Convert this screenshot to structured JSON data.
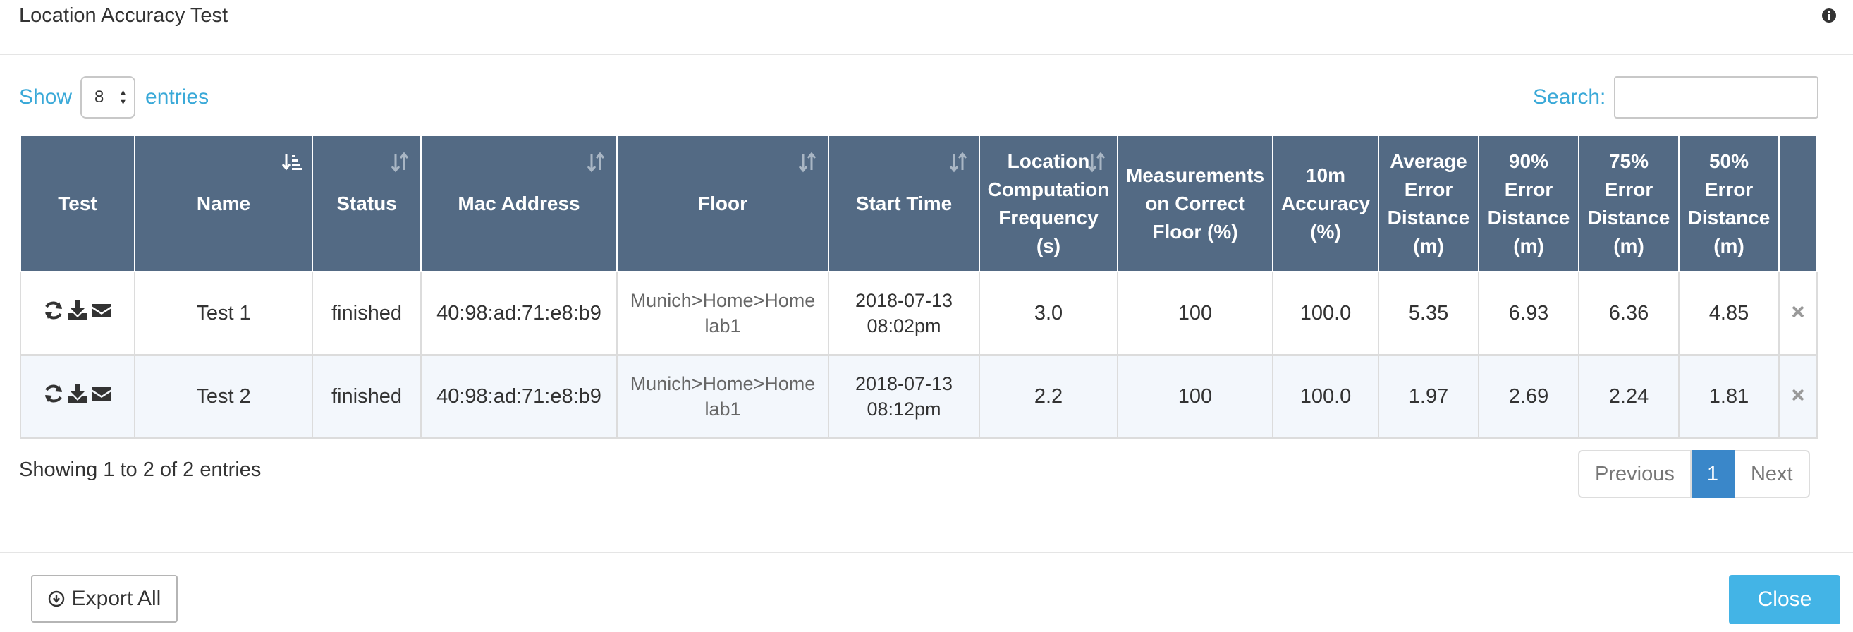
{
  "dialog": {
    "title": "Location Accuracy Test"
  },
  "toolbar": {
    "show_label": "Show",
    "page_length": "8",
    "entries_label": "entries",
    "search_label": "Search:",
    "search_value": ""
  },
  "table": {
    "columns": [
      "Test",
      "Name",
      "Status",
      "Mac Address",
      "Floor",
      "Start Time",
      "Location Computation Frequency (s)",
      "Measurements on Correct Floor (%)",
      "10m Accuracy (%)",
      "Average Error Distance (m)",
      "90% Error Distance (m)",
      "75% Error Distance (m)",
      "50% Error Distance (m)",
      ""
    ],
    "rows": [
      {
        "name": "Test 1",
        "status": "finished",
        "mac": "40:98:ad:71:e8:b9",
        "floor": "Munich>Home>Home lab1",
        "start_date": "2018-07-13",
        "start_clock": "08:02pm",
        "frequency": "3.0",
        "correct_floor": "100",
        "accuracy_10m": "100.0",
        "avg_error": "5.35",
        "err_90": "6.93",
        "err_75": "6.36",
        "err_50": "4.85"
      },
      {
        "name": "Test 2",
        "status": "finished",
        "mac": "40:98:ad:71:e8:b9",
        "floor": "Munich>Home>Home lab1",
        "start_date": "2018-07-13",
        "start_clock": "08:12pm",
        "frequency": "2.2",
        "correct_floor": "100",
        "accuracy_10m": "100.0",
        "avg_error": "1.97",
        "err_90": "2.69",
        "err_75": "2.24",
        "err_50": "1.81"
      }
    ],
    "row_icons": [
      "refresh-icon",
      "download-icon",
      "envelope-icon"
    ],
    "delete_icon": "close-icon"
  },
  "footer_info": {
    "text": "Showing 1 to 2 of 2 entries"
  },
  "pagination": {
    "previous": "Previous",
    "current": "1",
    "next": "Next"
  },
  "buttons": {
    "export_all": "Export All",
    "close": "Close"
  },
  "colors": {
    "header_bg": "#536a84",
    "link_blue": "#3aa9d8",
    "page_active": "#3a87c9",
    "close_button": "#43b4e6",
    "row_alt": "#f3f7fc"
  }
}
